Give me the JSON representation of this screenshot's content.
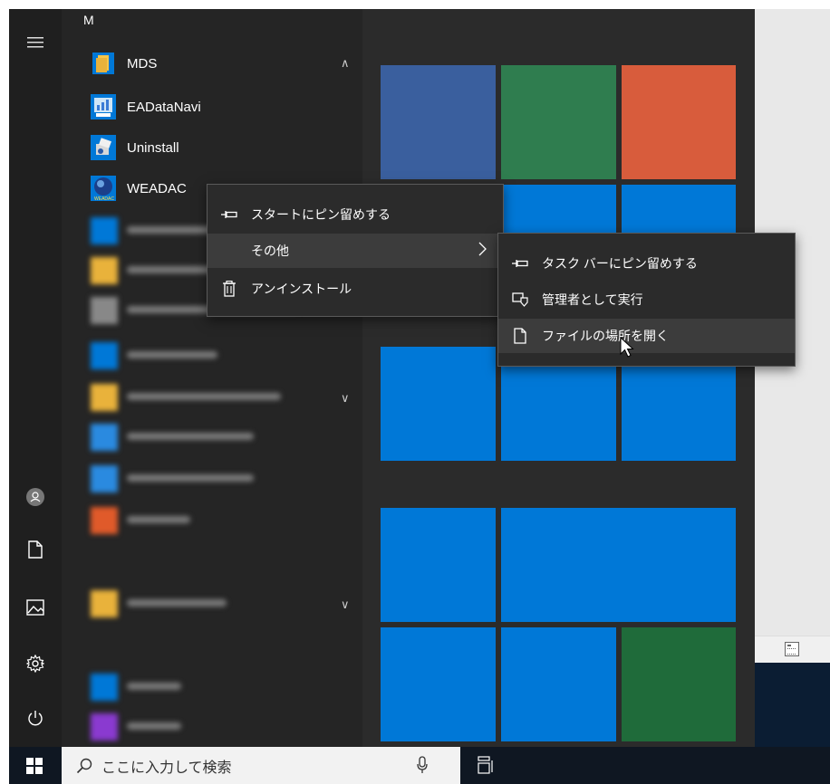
{
  "start_menu": {
    "section_letter": "M",
    "folder": {
      "label": "MDS",
      "expanded": true
    },
    "apps": [
      {
        "label": "EADataNavi",
        "icon": "eadatanavi-icon"
      },
      {
        "label": "Uninstall",
        "icon": "uninstall-icon"
      },
      {
        "label": "WEADAC",
        "icon": "weadac-icon",
        "icon_text": "WEADAC"
      }
    ]
  },
  "context_menu": {
    "items": [
      {
        "label": "スタートにピン留めする",
        "icon": "pin-icon"
      },
      {
        "label": "その他",
        "icon": "",
        "has_submenu": true
      },
      {
        "label": "アンインストール",
        "icon": "trash-icon"
      }
    ]
  },
  "submenu": {
    "items": [
      {
        "label": "タスク バーにピン留めする",
        "icon": "pin-icon"
      },
      {
        "label": "管理者として実行",
        "icon": "shield-icon"
      },
      {
        "label": "ファイルの場所を開く",
        "icon": "file-icon"
      }
    ]
  },
  "taskbar": {
    "search_placeholder": "ここに入力して検索"
  },
  "colors": {
    "tile_blue": "#0078d7",
    "tile_dark_blue": "#3a5f9e",
    "tile_green": "#2f7d4f",
    "tile_orange": "#d85c3c",
    "tile_dark_green": "#1f6b3a"
  }
}
